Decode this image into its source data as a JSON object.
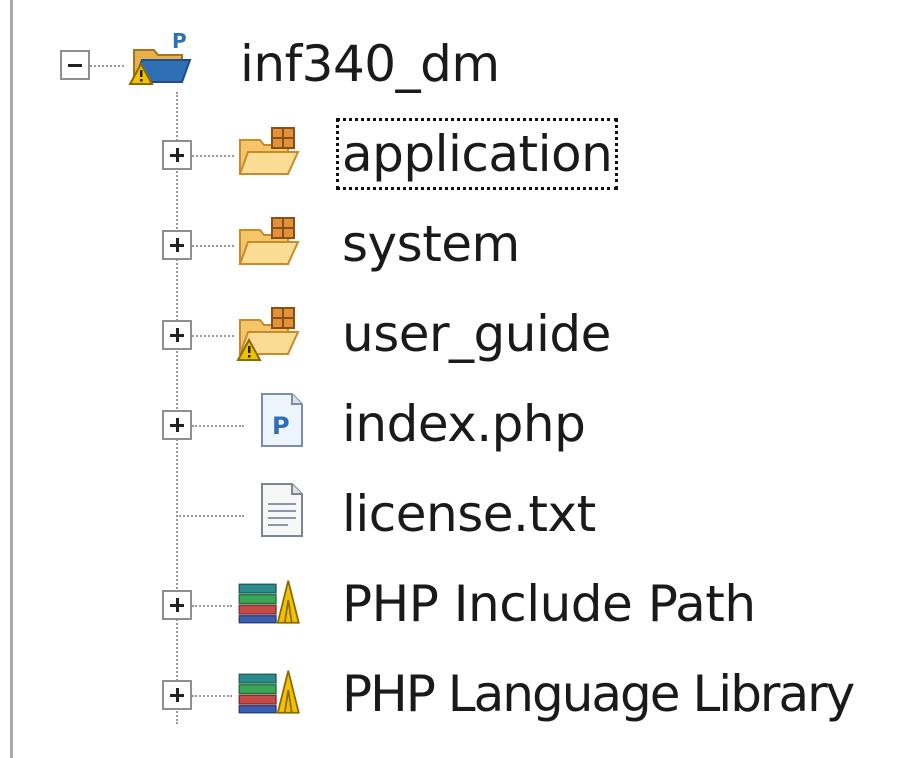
{
  "tree": {
    "root": {
      "label": "inf340_dm",
      "icon": "php-project-warning-icon",
      "expanded": true
    },
    "children": [
      {
        "label": "application",
        "icon": "package-folder-icon",
        "expandable": true,
        "focused": true
      },
      {
        "label": "system",
        "icon": "package-folder-icon",
        "expandable": true
      },
      {
        "label": "user_guide",
        "icon": "package-folder-warning-icon",
        "expandable": true
      },
      {
        "label": "index.php",
        "icon": "php-file-icon",
        "expandable": true
      },
      {
        "label": "license.txt",
        "icon": "text-file-icon",
        "expandable": false
      },
      {
        "label": "PHP Include Path",
        "icon": "library-icon",
        "expandable": true
      },
      {
        "label": "PHP Language Library",
        "icon": "library-icon",
        "expandable": true
      }
    ]
  },
  "colors": {
    "folder": "#f5c56a",
    "folder_dark": "#c98a2a",
    "warning": "#f2c200",
    "php_blue": "#2f6fb5",
    "guide_line": "#9a9a9a",
    "border": "#a9a9a9"
  }
}
